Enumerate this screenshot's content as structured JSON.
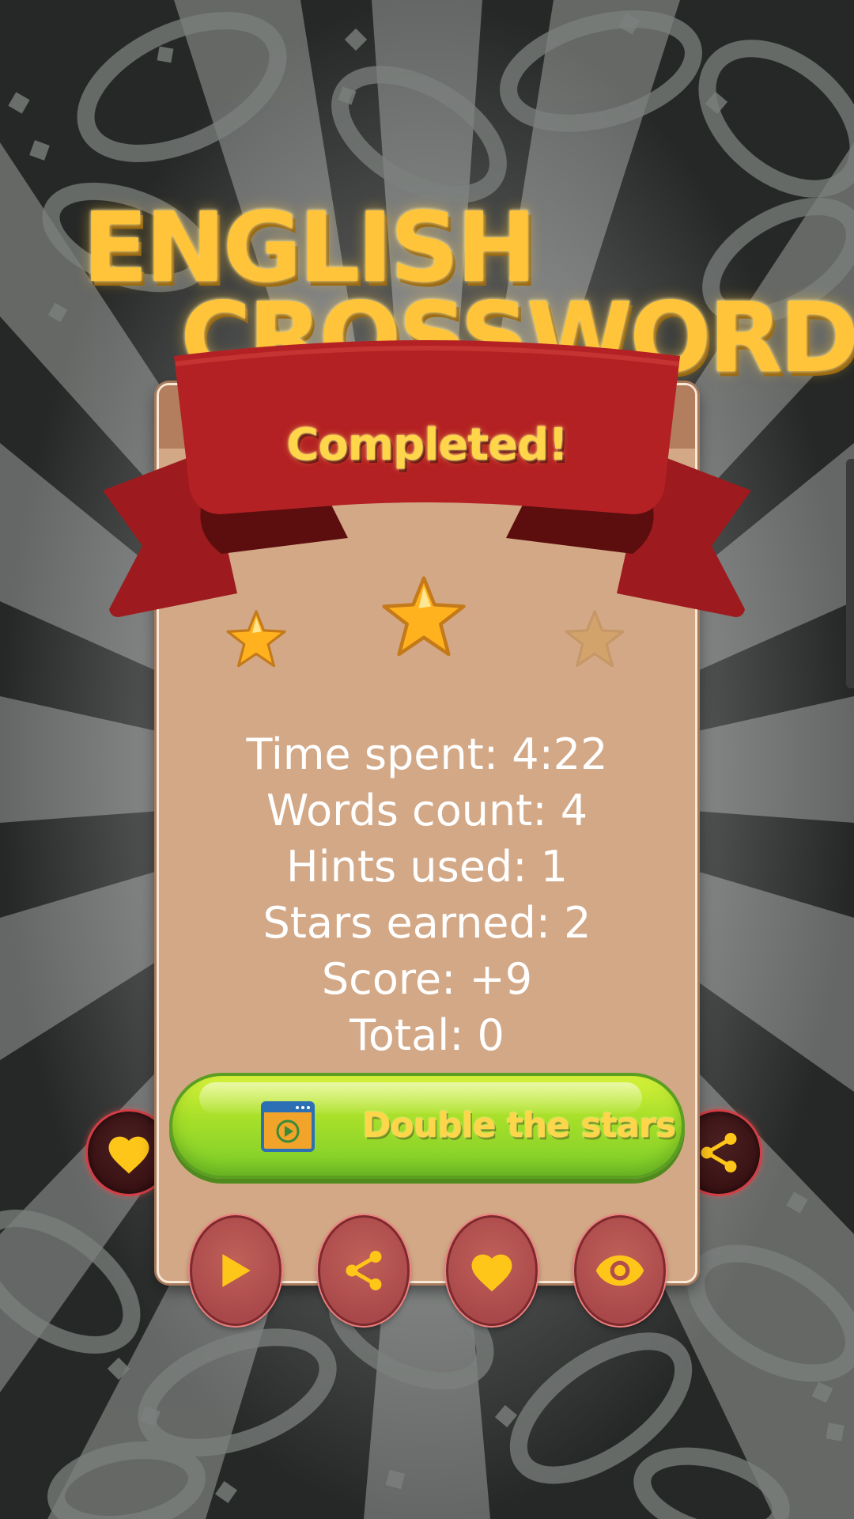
{
  "app": {
    "title_line1": "ENGLISH",
    "title_line2": "CROSSWORD"
  },
  "dialog": {
    "title": "Completed!",
    "stars": {
      "earned": 2,
      "total": 3
    },
    "stats": [
      "Time spent: 4:22",
      "Words count: 4",
      "Hints used: 1",
      "Stars earned: 2",
      "Score: +9",
      "Total: 0"
    ],
    "double_button": {
      "label": "Double the stars",
      "icon": "video-ad-icon"
    }
  },
  "side_buttons": {
    "left_icon": "heart-icon",
    "right_icon": "share-icon"
  },
  "bottom_buttons": [
    {
      "icon": "play-icon"
    },
    {
      "icon": "share-icon"
    },
    {
      "icon": "heart-icon"
    },
    {
      "icon": "eye-icon"
    }
  ],
  "colors": {
    "background": "#2a2c2b",
    "title_yellow": "#ffc43a",
    "panel": "#d3a886",
    "ribbon_red": "#b32124",
    "button_green": "#a9e02a",
    "icon_yellow": "#ffc61a"
  }
}
